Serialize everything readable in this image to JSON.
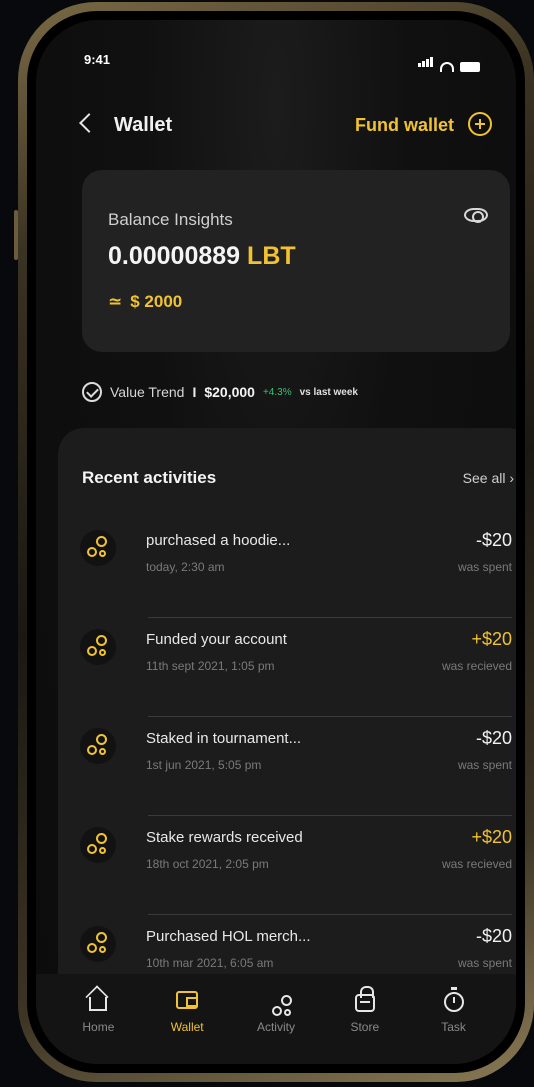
{
  "status_bar": {
    "time": "9:41"
  },
  "header": {
    "title": "Wallet",
    "fund_label": "Fund wallet"
  },
  "balance": {
    "label": "Balance Insights",
    "amount": "0.00000889",
    "unit": "LBT",
    "approx_symbol": "≃",
    "usd_value": "$ 2000"
  },
  "trend": {
    "label": "Value Trend",
    "separator": "I",
    "value": "$20,000",
    "change": "+4.3%",
    "suffix": "vs last week"
  },
  "activities": {
    "title": "Recent activities",
    "see_all": "See all  ›",
    "items": [
      {
        "name": "purchased a hoodie...",
        "date": "today, 2:30 am",
        "amount": "-$20",
        "note": "was spent",
        "kind": "spent"
      },
      {
        "name": "Funded your account",
        "date": "11th sept 2021, 1:05 pm",
        "amount": "+$20",
        "note": "was recieved",
        "kind": "received"
      },
      {
        "name": "Staked in tournament...",
        "date": "1st jun 2021, 5:05 pm",
        "amount": "-$20",
        "note": "was spent",
        "kind": "spent"
      },
      {
        "name": "Stake rewards received",
        "date": "18th oct 2021, 2:05 pm",
        "amount": "+$20",
        "note": "was recieved",
        "kind": "received"
      },
      {
        "name": "Purchased HOL merch...",
        "date": "10th mar 2021, 6:05 am",
        "amount": "-$20",
        "note": "was spent",
        "kind": "spent"
      }
    ]
  },
  "nav": {
    "items": [
      {
        "label": "Home",
        "icon": "home-icon"
      },
      {
        "label": "Wallet",
        "icon": "wallet-icon",
        "active": true
      },
      {
        "label": "Activity",
        "icon": "activity-icon"
      },
      {
        "label": "Store",
        "icon": "store-icon"
      },
      {
        "label": "Task",
        "icon": "timer-icon"
      }
    ]
  },
  "colors": {
    "accent": "#f1c232",
    "positive": "#38c172",
    "background": "#0c0c0c",
    "card": "#222222"
  }
}
